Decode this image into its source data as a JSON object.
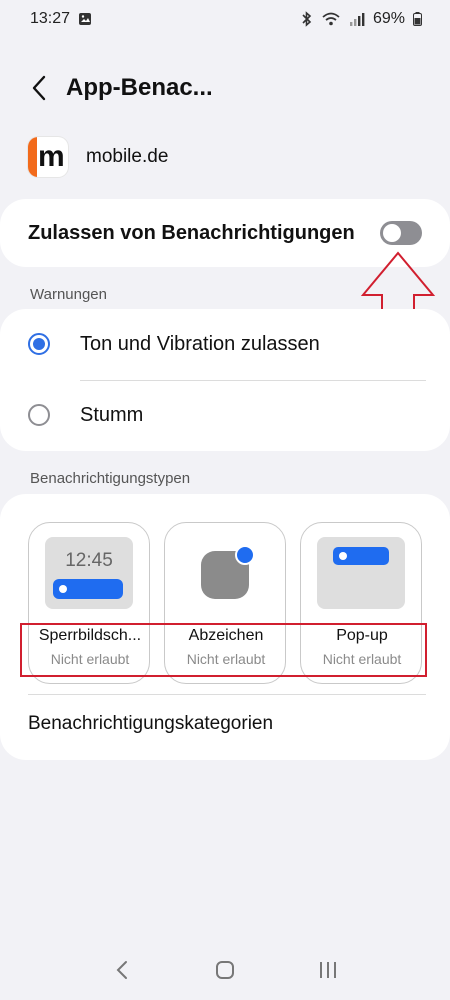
{
  "status_bar": {
    "time": "13:27",
    "battery": "69%",
    "icons": [
      "gallery-icon",
      "bluetooth-icon",
      "wifi-icon",
      "signal-icon",
      "battery-icon"
    ]
  },
  "header": {
    "title": "App-Benac..."
  },
  "app": {
    "name": "mobile.de",
    "logo_letter": "m",
    "logo_color": "#f26a1b"
  },
  "allow": {
    "label": "Zulassen von Benachrichtigungen",
    "enabled": false
  },
  "warnings": {
    "section_title": "Warnungen",
    "options": [
      {
        "label": "Ton und Vibration zulassen",
        "selected": true
      },
      {
        "label": "Stumm",
        "selected": false
      }
    ]
  },
  "notification_types": {
    "section_title": "Benachrichtigungstypen",
    "tiles": [
      {
        "name": "Sperrbildsch...",
        "state": "Nicht erlaubt",
        "preview_time": "12:45"
      },
      {
        "name": "Abzeichen",
        "state": "Nicht erlaubt"
      },
      {
        "name": "Pop-up",
        "state": "Nicht erlaubt"
      }
    ],
    "categories_label": "Benachrichtigungskategorien"
  },
  "colors": {
    "accent": "#1f6cf0",
    "radio_accent": "#2f6fe4",
    "annotation": "#d11f2f",
    "background": "#f2f2f6"
  }
}
